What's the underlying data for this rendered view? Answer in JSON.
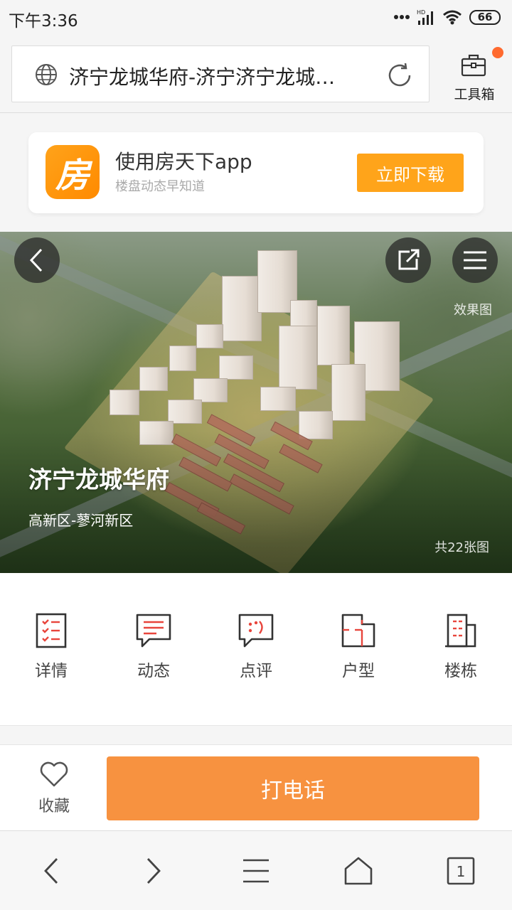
{
  "status_bar": {
    "time": "下午3:36",
    "battery": "66",
    "network": "HD"
  },
  "address_bar": {
    "url_title": "济宁龙城华府-济宁济宁龙城…"
  },
  "toolbox": {
    "label": "工具箱"
  },
  "app_banner": {
    "logo_char": "房",
    "title": "使用房天下app",
    "subtitle": "楼盘动态早知道",
    "download_label": "立即下载"
  },
  "hero": {
    "effect_label": "效果图",
    "project_name": "济宁龙城华府",
    "area": "高新区-蓼河新区",
    "photo_count": "共22张图"
  },
  "nav": [
    {
      "label": "详情",
      "icon": "details-list-icon"
    },
    {
      "label": "动态",
      "icon": "news-message-icon"
    },
    {
      "label": "点评",
      "icon": "review-comment-icon"
    },
    {
      "label": "户型",
      "icon": "floorplan-icon"
    },
    {
      "label": "楼栋",
      "icon": "building-icon"
    }
  ],
  "action_bar": {
    "favorite_label": "收藏",
    "call_label": "打电话"
  },
  "browser_nav": {
    "tab_count": "1"
  },
  "colors": {
    "accent": "#f79240",
    "download": "#ffa41a",
    "icon_red": "#e8453c",
    "icon_dark": "#333333"
  }
}
